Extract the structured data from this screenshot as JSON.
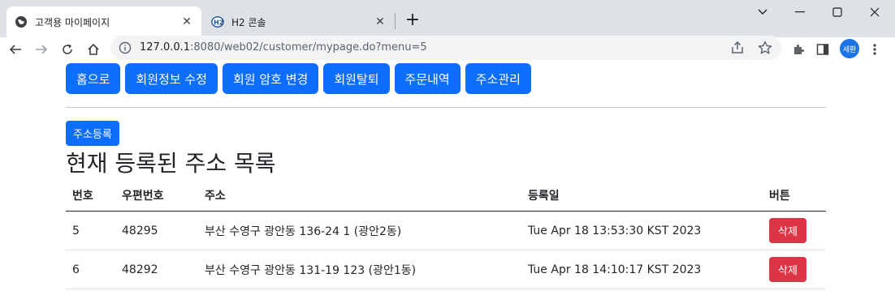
{
  "browser": {
    "tabs": [
      {
        "title": "고객용 마이페이지",
        "active": true,
        "favicon": "globe-icon"
      },
      {
        "title": "H2 콘솔",
        "active": false,
        "favicon": "h2-logo-icon"
      }
    ],
    "url_host": "127.0.0.1",
    "url_rest": ":8080/web02/customer/mypage.do?menu=5",
    "profile_initials": "세환"
  },
  "nav": {
    "home": "홈으로",
    "edit_info": "회원정보 수정",
    "change_pw": "회원 암호 변경",
    "withdraw": "회원탈퇴",
    "orders": "주문내역",
    "address_mgmt": "주소관리"
  },
  "address": {
    "add_button": "주소등록",
    "title": "현재 등록된 주소 목록",
    "columns": [
      "번호",
      "우편번호",
      "주소",
      "등록일",
      "버튼"
    ],
    "rows": [
      {
        "no": "5",
        "zip": "48295",
        "addr": "부산 수영구 광안동 136-24 1 (광안2동)",
        "date": "Tue Apr 18 13:53:30 KST 2023",
        "action": "삭제"
      },
      {
        "no": "6",
        "zip": "48292",
        "addr": "부산 수영구 광안동 131-19 123 (광안1동)",
        "date": "Tue Apr 18 14:10:17 KST 2023",
        "action": "삭제"
      }
    ]
  },
  "colors": {
    "primary": "#0d6efd",
    "danger": "#dc3545",
    "chrome_bg": "#dee1e6"
  }
}
